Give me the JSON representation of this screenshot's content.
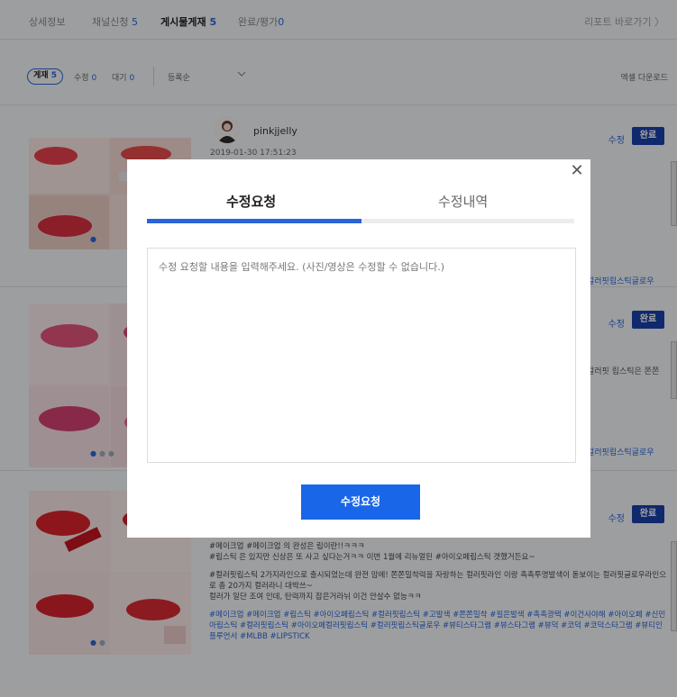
{
  "topbar": {
    "tabs": [
      {
        "label": "상세정보",
        "count": ""
      },
      {
        "label": "채널신청",
        "count": "5"
      },
      {
        "label": "게시물게재",
        "count": "5"
      },
      {
        "label": "완료/평가",
        "count": "0"
      }
    ],
    "report_link": "리포트 바로가기 〉"
  },
  "filters": {
    "chip_label": "게재",
    "chip_count": "5",
    "edit_label": "수정",
    "edit_count": "0",
    "wait_label": "대기",
    "wait_count": "0",
    "sort_label": "등록순",
    "excel_label": "엑셀 다운로드"
  },
  "posts": [
    {
      "author": "pinkjjelly",
      "timestamp": "2019-01-30 17:51:23",
      "edit_label": "수정",
      "done_label": "완료",
      "side_text": "컬러핏립스틱글로우"
    },
    {
      "edit_label": "수정",
      "done_label": "완료",
      "side_text_1": "컬러핏 립스틱은 쫀쫀",
      "side_text_2": "컬러핏립스틱글로우"
    },
    {
      "edit_label": "수정",
      "done_label": "완료",
      "line1": "#메이크업 #메이크업 의 완성은 립이란!!ㅋㅋㅋ",
      "line2": "#립스틱 은 있지만 신상은 또 사고 싶다는거ㅋㅋ 이번 1월에 리뉴얼된 #아이오페립스틱 갯했거든요~",
      "line3": "#컬러핏립스틱 2가지라인으로 출시되었는데 완전 맘에! 쫀쫀밀착력을 자랑하는 컬러핏라인 이랑 촉촉투명발색이 돋보이는 컬러핏글로우라인으로 총 20가지 컬러라니 대박쓰~",
      "line4": "컬러가 일단 조여 인데, 탄력까지 잡은거라뉘 이건 안살수 없능ㅋㅋ",
      "tags": "#메이크업 #메이크업 #립스틱 #아이오페립스틱 #컬러핏립스틱 #고발색 #쫀쫀밀착 #필은발색 #촉촉광택 #이건사야해 #아이오페 #신민아립스틱 #컬러핏립스틱 #아이오페컬러핏립스틱 #컬러핏립스틱글로우 #뷰티스타그램 #뷰스타그램 #뷰덕 #코덕 #코덕스타그램 #뷰티인플루언서 #MLBB #LIPSTICK"
    }
  ],
  "modal": {
    "tab_request": "수정요청",
    "tab_history": "수정내역",
    "placeholder": "수정 요청할 내용을 입력해주세요. (사진/영상은 수정할 수 없습니다.)",
    "submit_label": "수정요청",
    "close_glyph": "✕"
  },
  "colors": {
    "accent": "#2b64d8",
    "done_button": "#1a3fa8",
    "submit_button": "#1a66e8"
  }
}
